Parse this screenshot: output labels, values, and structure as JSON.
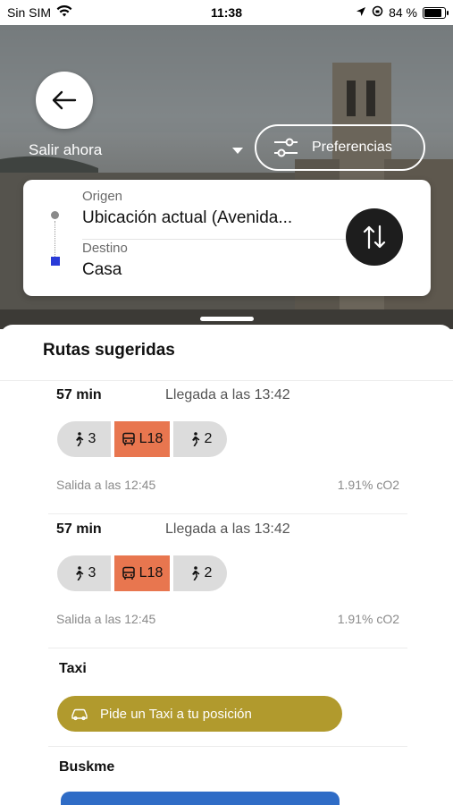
{
  "status_bar": {
    "carrier": "Sin SIM",
    "time": "11:38",
    "battery": "84 %"
  },
  "header": {
    "depart_label": "Salir ahora",
    "preferences_label": "Preferencias"
  },
  "trip": {
    "origin_label": "Origen",
    "origin_value": "Ubicación actual (Avenida...",
    "destination_label": "Destino",
    "destination_value": "Casa"
  },
  "sheet": {
    "title": "Rutas sugeridas",
    "routes": [
      {
        "duration": "57 min",
        "arrival": "Llegada a las 13:42",
        "walk1": "3",
        "bus": "L18",
        "walk2": "2",
        "departure": "Salida a las 12:45",
        "co2": "1.91% cO2"
      },
      {
        "duration": "57 min",
        "arrival": "Llegada a las 13:42",
        "walk1": "3",
        "bus": "L18",
        "walk2": "2",
        "departure": "Salida a las 12:45",
        "co2": "1.91% cO2"
      }
    ],
    "taxi": {
      "title": "Taxi",
      "button_label": "Pide un Taxi a tu posición"
    },
    "buskme": {
      "title": "Buskme"
    }
  },
  "colors": {
    "bus_chip": "#e8764f",
    "taxi_button": "#b19a2d",
    "destination_marker": "#2a3bd8",
    "buskme_button": "#2f6cc6"
  },
  "icons": [
    "wifi-icon",
    "location-arrow-icon",
    "rotation-lock-icon",
    "battery-icon",
    "back-arrow-icon",
    "sliders-icon",
    "swap-icon",
    "walk-icon",
    "bus-icon",
    "taxi-icon"
  ]
}
